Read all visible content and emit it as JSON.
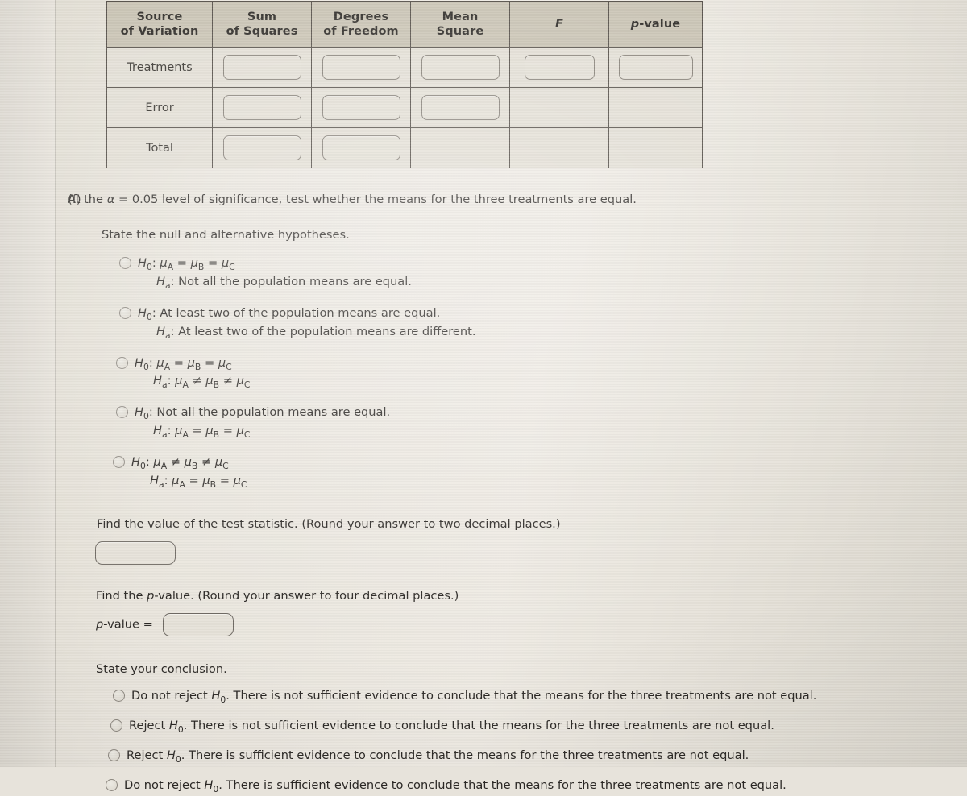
{
  "anova_table": {
    "name": "ANOVA summary table",
    "headers": [
      {
        "line1": "Source",
        "line2": "of Variation"
      },
      {
        "line1": "Sum",
        "line2": "of Squares"
      },
      {
        "line1": "Degrees",
        "line2": "of Freedom"
      },
      {
        "line1": "Mean",
        "line2": "Square"
      },
      {
        "line1": "F",
        "line2": ""
      },
      {
        "line1": "p-value",
        "line2": ""
      }
    ],
    "rows": [
      {
        "label": "Treatments",
        "inputs": [
          true,
          true,
          true,
          true,
          true
        ],
        "values": [
          "",
          "",
          "",
          "",
          ""
        ]
      },
      {
        "label": "Error",
        "inputs": [
          true,
          true,
          true,
          false,
          false
        ],
        "values": [
          "",
          "",
          "",
          "",
          ""
        ]
      },
      {
        "label": "Total",
        "inputs": [
          true,
          true,
          false,
          false,
          false
        ],
        "values": [
          "",
          "",
          "",
          "",
          ""
        ]
      }
    ]
  },
  "question": {
    "label": "(f)",
    "stem_pre": "At the ",
    "stem_alpha": "α",
    "stem_post": " = 0.05 level of significance, test whether the means for the three treatments are equal.",
    "hypotheses_prompt": "State the null and alternative hypotheses.",
    "hypothesis_options": [
      {
        "null_prefix": "H",
        "null_sub": "0",
        "null_text": ": μᴀ = μʙ = μꜱ",
        "alt_prefix": "H",
        "alt_sub": "a",
        "alt_text": ": Not all the population means are equal.",
        "null_plain": "H0: μA = μB = μC",
        "alt_plain": "Ha: Not all the population means are equal."
      },
      {
        "null_plain": "H0: At least two of the population means are equal.",
        "alt_plain": "Ha: At least two of the population means are different."
      },
      {
        "null_plain": "H0: μA = μB = μC",
        "alt_plain": "Ha: μA ≠ μB ≠ μC"
      },
      {
        "null_plain": "H0: Not all the population means are equal.",
        "alt_plain": "Ha: μA = μB = μC"
      },
      {
        "null_plain": "H0: μA ≠ μB ≠ μC",
        "alt_plain": "Ha: μA = μB = μC"
      }
    ],
    "test_statistic_prompt": "Find the value of the test statistic. (Round your answer to two decimal places.)",
    "test_statistic_value": "",
    "p_value_prompt_pre": "Find the ",
    "p_value_prompt_italic": "p",
    "p_value_prompt_post": "-value. (Round your answer to four decimal places.)",
    "p_value_label_italic": "p",
    "p_value_label_post": "-value =",
    "p_value_value": "",
    "conclusion_prompt": "State your conclusion.",
    "conclusion_options": [
      {
        "lead": "Do not reject ",
        "hyp": "H",
        "sub": "0",
        "rest": ". There is not sufficient evidence to conclude that the means for the three treatments are not equal."
      },
      {
        "lead": "Reject ",
        "hyp": "H",
        "sub": "0",
        "rest": ". There is not sufficient evidence to conclude that the means for the three treatments are not equal."
      },
      {
        "lead": "Reject ",
        "hyp": "H",
        "sub": "0",
        "rest": ". There is sufficient evidence to conclude that the means for the three treatments are not equal."
      },
      {
        "lead": "Do not reject ",
        "hyp": "H",
        "sub": "0",
        "rest": ". There is sufficient evidence to conclude that the means for the three treatments are not equal."
      }
    ]
  },
  "symbols": {
    "mu": "μ",
    "equals": "=",
    "not_equals": "≠",
    "alpha": "α"
  },
  "colors": {
    "page_background": "#e7e3da",
    "table_header_bg": "#c7c1b0",
    "table_cell_bg": "#e2ded4",
    "table_border": "#4a443d",
    "input_border": "#817b72",
    "text": "#2a2724",
    "radio_border": "#8d8880"
  }
}
